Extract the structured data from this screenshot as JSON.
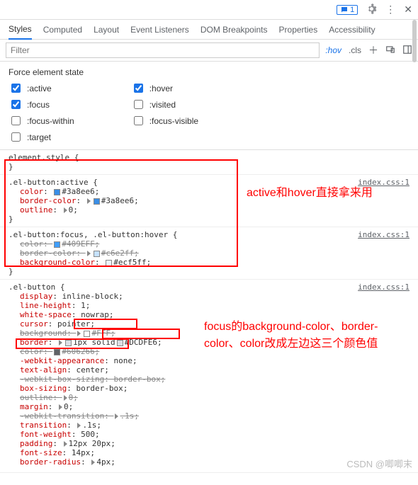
{
  "toolbar": {
    "badge_count": "1"
  },
  "tabs": [
    "Styles",
    "Computed",
    "Layout",
    "Event Listeners",
    "DOM Breakpoints",
    "Properties",
    "Accessibility"
  ],
  "filter": {
    "placeholder": "Filter",
    "hov": ":hov",
    "cls": ".cls"
  },
  "states": {
    "title": "Force element state",
    "col1": [
      {
        "label": ":active",
        "checked": true
      },
      {
        "label": ":focus",
        "checked": true
      },
      {
        "label": ":focus-within",
        "checked": false
      },
      {
        "label": ":target",
        "checked": false
      }
    ],
    "col2": [
      {
        "label": ":hover",
        "checked": true
      },
      {
        "label": ":visited",
        "checked": false
      },
      {
        "label": ":focus-visible",
        "checked": false
      }
    ]
  },
  "rules": {
    "r0": {
      "selector": "element.style {",
      "close": "}"
    },
    "r1": {
      "selector": ".el-button:active {",
      "src": "index.css:1",
      "props": [
        {
          "name": "color",
          "val": "#3a8ee6",
          "swatch": "#3a8ee6",
          "struck": false
        },
        {
          "name": "border-color",
          "val": "#3a8ee6",
          "swatch": "#3a8ee6",
          "tri": true,
          "struck": false
        },
        {
          "name": "outline",
          "val": "0",
          "tri": true,
          "struck": false
        }
      ],
      "close": "}"
    },
    "r2": {
      "selector": ".el-button:focus, .el-button:hover {",
      "src": "index.css:1",
      "props": [
        {
          "name": "color",
          "val": "#409EFF",
          "swatch": "#409EFF",
          "struck": true
        },
        {
          "name": "border-color",
          "val": "#c6e2ff",
          "swatch": "#c6e2ff",
          "tri": true,
          "struck": true
        },
        {
          "name": "background-color",
          "val": "#ecf5ff",
          "swatch": "#ecf5ff",
          "struck": false
        }
      ],
      "close": "}"
    },
    "r3": {
      "selector": ".el-button {",
      "src": "index.css:1",
      "props": [
        {
          "name": "display",
          "val": "inline-block"
        },
        {
          "name": "line-height",
          "val": "1"
        },
        {
          "name": "white-space",
          "val": "nowrap"
        },
        {
          "name": "cursor",
          "val": "pointer"
        },
        {
          "name": "background",
          "val": "#FFF",
          "swatch": "#FFFFFF",
          "tri": true,
          "boxed": true,
          "struck": true
        },
        {
          "name": "border",
          "val": "1px solid",
          "val2": "#DCDFE6",
          "swatch": "#DCDFE6",
          "tri": true,
          "boxed": true
        },
        {
          "name": "color",
          "val": "#606266",
          "swatch": "#606266",
          "boxed": true,
          "struck": true
        },
        {
          "name": "-webkit-appearance",
          "val": "none"
        },
        {
          "name": "text-align",
          "val": "center"
        },
        {
          "name": "-webkit-box-sizing",
          "val": "border-box",
          "struck": true
        },
        {
          "name": "box-sizing",
          "val": "border-box"
        },
        {
          "name": "outline",
          "val": "0",
          "tri": true,
          "struck": true
        },
        {
          "name": "margin",
          "val": "0",
          "tri": true
        },
        {
          "name": "-webkit-transition",
          "val": ".1s",
          "tri": true,
          "struck": true
        },
        {
          "name": "transition",
          "val": ".1s",
          "tri": true
        },
        {
          "name": "font-weight",
          "val": "500"
        },
        {
          "name": "padding",
          "val": "12px 20px",
          "tri": true
        },
        {
          "name": "font-size",
          "val": "14px"
        },
        {
          "name": "border-radius",
          "val": "4px",
          "tri": true
        }
      ]
    }
  },
  "annotations": {
    "a1": "active和hover直接拿来用",
    "a2": "focus的background-color、border-color、color改成左边这三个颜色值"
  },
  "watermark": "CSDN @唧唧末"
}
